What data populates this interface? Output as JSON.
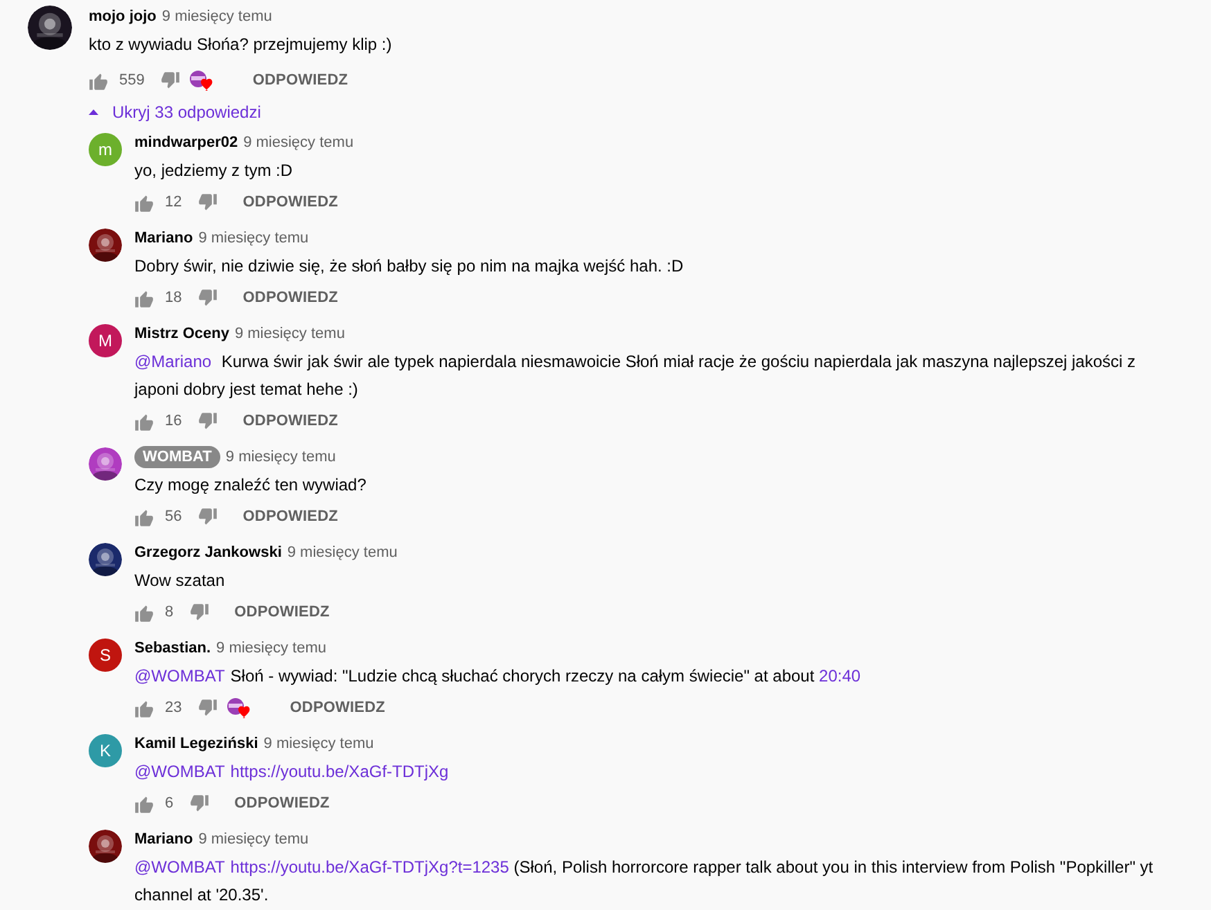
{
  "comment": {
    "author": "mojo jojo",
    "owner": false,
    "time": "9 miesięcy temu",
    "avatar": {
      "kind": "picture",
      "color": "#1a1420"
    },
    "body": [
      {
        "kind": "text",
        "text": "kto z wywiadu Słońa? przejmujemy klip :)"
      }
    ],
    "likes": "559",
    "hearted": true,
    "reply_label": "ODPOWIEDZ"
  },
  "toggle_replies": {
    "label": "Ukryj 33 odpowiedzi",
    "expanded": true
  },
  "replies": [
    {
      "author": "mindwarper02",
      "owner": false,
      "time": "9 miesięcy temu",
      "avatar": {
        "kind": "letter",
        "letter": "m",
        "color": "#6cb02c"
      },
      "body": [
        {
          "kind": "text",
          "text": "yo, jedziemy z tym :D"
        }
      ],
      "likes": "12",
      "hearted": false,
      "reply_label": "ODPOWIEDZ"
    },
    {
      "author": "Mariano",
      "owner": false,
      "time": "9 miesięcy temu",
      "avatar": {
        "kind": "picture",
        "color": "#7a0e0e"
      },
      "body": [
        {
          "kind": "text",
          "text": "Dobry świr, nie dziwie się, że słoń bałby się po nim na majka wejść hah. :D"
        }
      ],
      "likes": "18",
      "hearted": false,
      "reply_label": "ODPOWIEDZ"
    },
    {
      "author": "Mistrz Oceny",
      "owner": false,
      "time": "9 miesięcy temu",
      "avatar": {
        "kind": "letter",
        "letter": "M",
        "color": "#c2185b"
      },
      "body": [
        {
          "kind": "mention",
          "text": "@Mariano"
        },
        {
          "kind": "text",
          "text": " Kurwa świr jak świr ale typek napierdala niesmawoicie Słoń miał racje że gościu napierdala jak maszyna najlepszej jakości z japoni dobry jest temat hehe :)"
        }
      ],
      "likes": "16",
      "hearted": false,
      "reply_label": "ODPOWIEDZ"
    },
    {
      "author": "WOMBAT",
      "owner": true,
      "time": "9 miesięcy temu",
      "avatar": {
        "kind": "picture",
        "color": "#b03cc0"
      },
      "body": [
        {
          "kind": "text",
          "text": "Czy mogę znaleźć ten wywiad?"
        }
      ],
      "likes": "56",
      "hearted": false,
      "reply_label": "ODPOWIEDZ"
    },
    {
      "author": "Grzegorz Jankowski",
      "owner": false,
      "time": "9 miesięcy temu",
      "avatar": {
        "kind": "picture",
        "color": "#1b2a6b"
      },
      "body": [
        {
          "kind": "text",
          "text": "Wow szatan"
        }
      ],
      "likes": "8",
      "hearted": false,
      "reply_label": "ODPOWIEDZ"
    },
    {
      "author": "Sebastian.",
      "owner": false,
      "time": "9 miesięcy temu",
      "avatar": {
        "kind": "letter",
        "letter": "S",
        "color": "#c0150f"
      },
      "body": [
        {
          "kind": "mention",
          "text": "@WOMBAT"
        },
        {
          "kind": "text",
          "text": "Słoń - wywiad: \"Ludzie chcą słuchać chorych rzeczy na całym świecie\" at about "
        },
        {
          "kind": "link",
          "text": "20:40"
        }
      ],
      "likes": "23",
      "hearted": true,
      "reply_label": "ODPOWIEDZ"
    },
    {
      "author": "Kamil Legeziński",
      "owner": false,
      "time": "9 miesięcy temu",
      "avatar": {
        "kind": "letter",
        "letter": "K",
        "color": "#2e9aa6"
      },
      "body": [
        {
          "kind": "mention",
          "text": "@WOMBAT"
        },
        {
          "kind": "link",
          "text": "https://youtu.be/XaGf-TDTjXg"
        }
      ],
      "likes": "6",
      "hearted": false,
      "reply_label": "ODPOWIEDZ"
    },
    {
      "author": "Mariano",
      "owner": false,
      "time": "9 miesięcy temu",
      "avatar": {
        "kind": "picture",
        "color": "#7a0e0e"
      },
      "body": [
        {
          "kind": "mention",
          "text": "@WOMBAT"
        },
        {
          "kind": "link",
          "text": "https://youtu.be/XaGf-TDTjXg?t=1235"
        },
        {
          "kind": "text",
          "text": " (Słoń, Polish horrorcore rapper talk about you in this interview from Polish \"Popkiller\" yt channel at '20.35'."
        }
      ]
    }
  ]
}
